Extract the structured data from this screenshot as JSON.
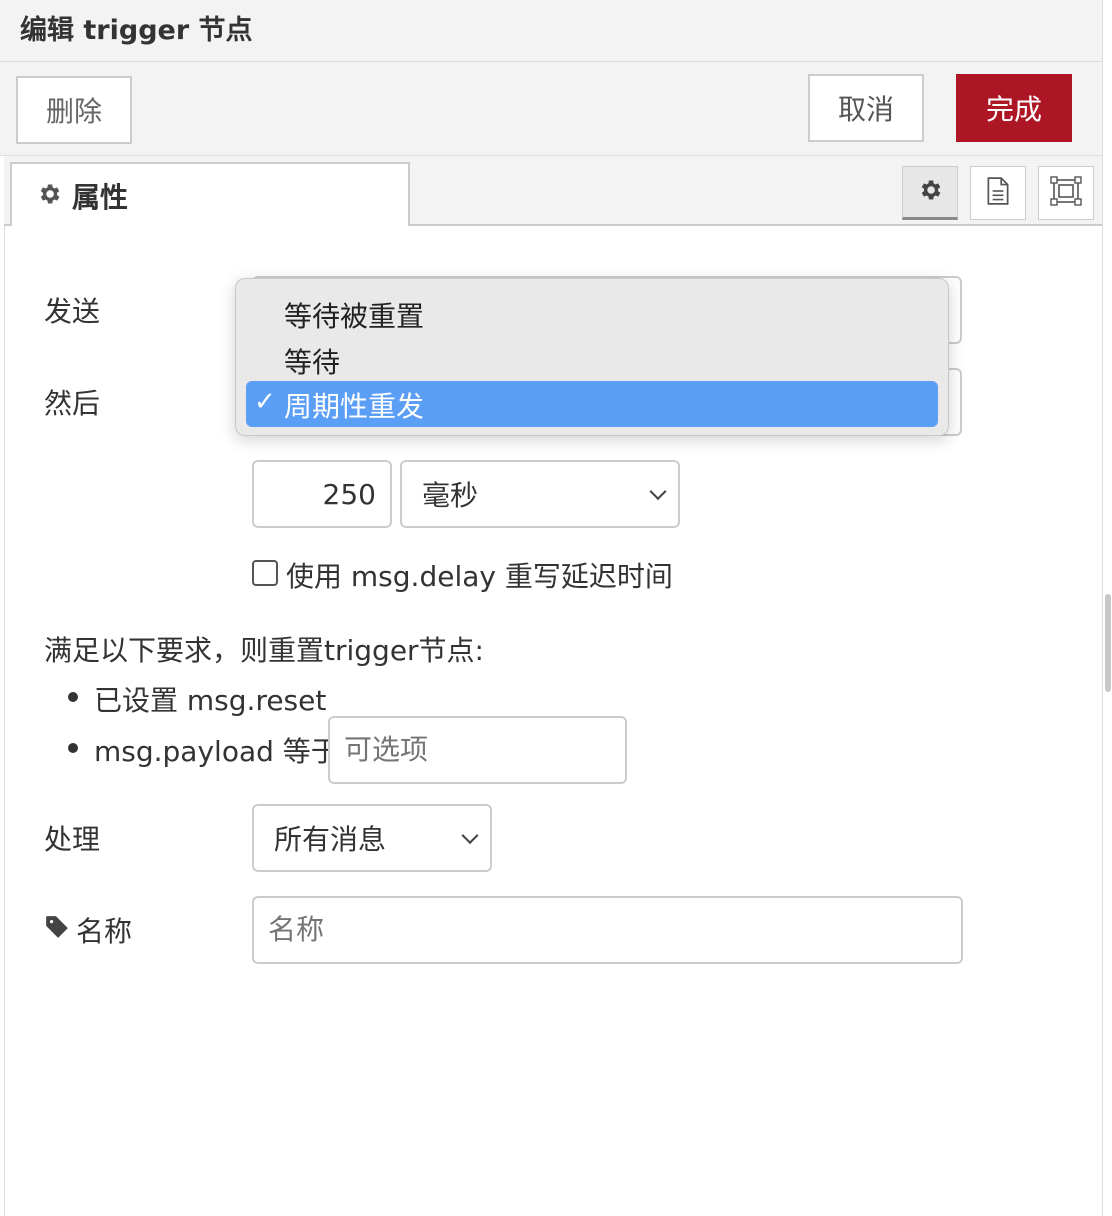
{
  "header": {
    "title": "编辑 trigger 节点"
  },
  "toolbar": {
    "delete_label": "删除",
    "cancel_label": "取消",
    "done_label": "完成",
    "done_color": "#ad1625"
  },
  "tabs": {
    "properties_label": "属性"
  },
  "form": {
    "send_label": "发送",
    "then_label": "然后",
    "interval_value": "250",
    "unit_value": "毫秒",
    "override_delay_label": "使用 msg.delay 重写延迟时间",
    "reset_heading": "满足以下要求，则重置trigger节点:",
    "reset_item1": "已设置 msg.reset",
    "reset_item2_prefix": "msg.payload 等于",
    "reset_payload_placeholder": "可选项",
    "handling_label": "处理",
    "handling_value": "所有消息",
    "name_label": "名称",
    "name_placeholder": "名称"
  },
  "dropdown": {
    "options": [
      "等待被重置",
      "等待",
      "周期性重发"
    ],
    "selected": "周期性重发",
    "selected_color": "#5b9ef6"
  },
  "icons": [
    "gear-icon",
    "document-icon",
    "frame-icon",
    "tag-icon",
    "checkmark-icon",
    "chevron-down-icon"
  ]
}
